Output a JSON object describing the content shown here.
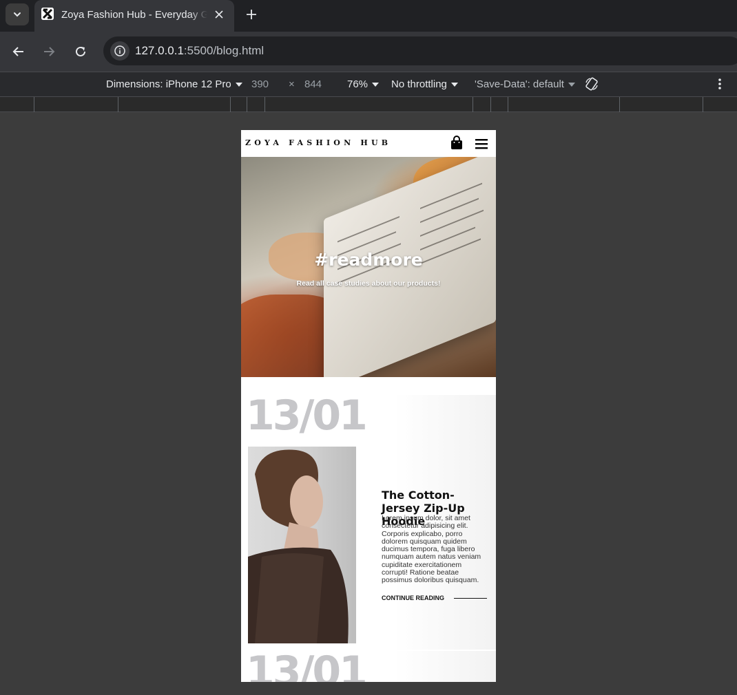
{
  "browser": {
    "tab_title": "Zoya Fashion Hub - Everyday Gr",
    "url_host": "127.0.0.1",
    "url_path": ":5500/blog.html"
  },
  "devtools": {
    "dimensions_label": "Dimensions: iPhone 12 Pro",
    "width": "390",
    "times": "×",
    "height": "844",
    "zoom": "76%",
    "throttling": "No throttling",
    "save_data": "'Save-Data': default"
  },
  "site": {
    "logo": "ZOYA FASHION HUB",
    "hero": {
      "title": "#readmore",
      "subtitle": "Read all case studies about our products!"
    },
    "posts": [
      {
        "date": "13/01",
        "title": "The Cotton-Jersey Zip-Up Hoodie",
        "body": "Lorem ipsum dolor, sit amet consectetur adipisicing elit. Corporis explicabo, porro dolorem quisquam quidem ducimus tempora, fuga libero numquam autem natus veniam cupiditate exercitationem corrupti! Ratione beatae possimus doloribus quisquam.",
        "cta": "CONTINUE READING"
      },
      {
        "date": "13/01"
      }
    ]
  }
}
